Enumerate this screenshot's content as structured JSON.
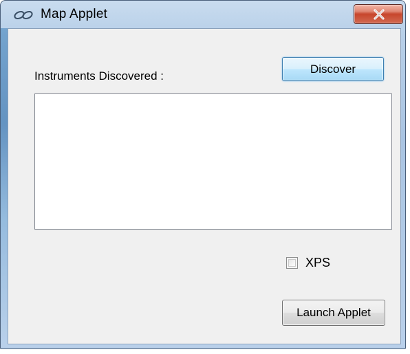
{
  "window": {
    "title": "Map Applet",
    "icon": "link-chain-icon",
    "close_label": "x"
  },
  "main": {
    "instruments_label": "Instruments Discovered :",
    "discover_button": "Discover",
    "instrument_list": [],
    "xps_checkbox": {
      "label": "XPS",
      "checked": false
    },
    "launch_button": "Launch Applet"
  },
  "colors": {
    "frame": "#b7cfe8",
    "client": "#f0f0f0",
    "close_button": "#c7462c",
    "default_button_border": "#3c7fb1"
  }
}
